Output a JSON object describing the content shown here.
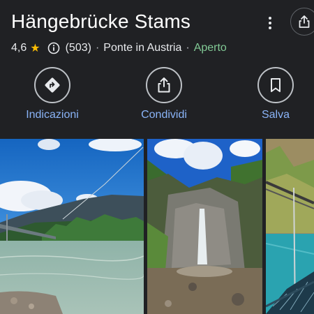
{
  "place": {
    "title": "Hängebrücke Stams",
    "rating": "4,6",
    "reviews": "(503)",
    "category": "Ponte in Austria",
    "status": "Aperto",
    "separator": "·"
  },
  "actions": [
    {
      "label": "Indicazioni",
      "icon": "directions-icon"
    },
    {
      "label": "Condividi",
      "icon": "share-icon"
    },
    {
      "label": "Salva",
      "icon": "bookmark-icon"
    }
  ],
  "colors": {
    "background": "#202124",
    "accent": "#8ab4f8",
    "open": "#81c995",
    "star": "#fbbc04"
  },
  "photos": [
    {
      "subject": "suspension-bridge-over-river"
    },
    {
      "subject": "waterfall-in-forest"
    },
    {
      "subject": "bridge-walkway-view"
    }
  ]
}
